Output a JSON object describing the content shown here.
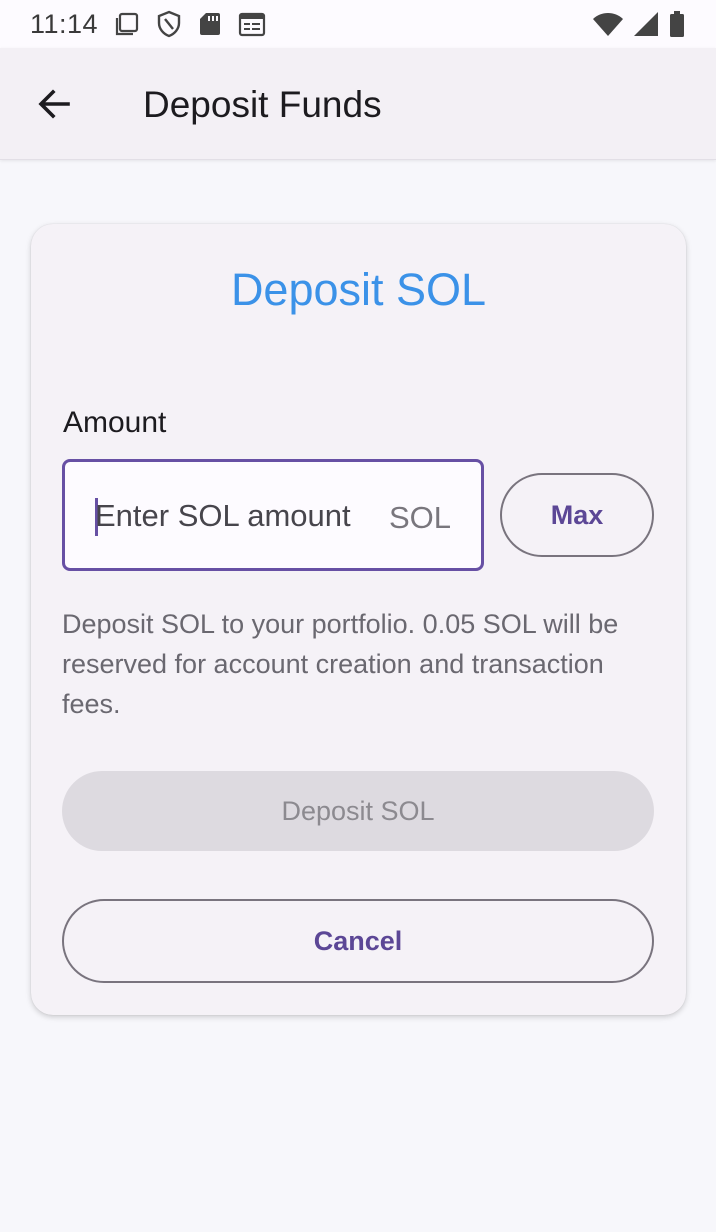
{
  "status_bar": {
    "time": "11:14",
    "icons": [
      "screenshot-icon",
      "vpn-shield-icon",
      "sd-card-icon",
      "calendar-icon",
      "wifi-icon",
      "signal-icon",
      "battery-icon"
    ]
  },
  "app_bar": {
    "back_icon": "arrow-back-icon",
    "title": "Deposit Funds"
  },
  "card": {
    "title": "Deposit SOL",
    "amount_label": "Amount",
    "amount_input": {
      "value": "",
      "placeholder": "Enter SOL amount",
      "suffix": "SOL"
    },
    "max_label": "Max",
    "helper_text": "Deposit SOL to your portfolio. 0.05 SOL will be reserved for account creation and transaction fees.",
    "deposit_label": "Deposit SOL",
    "deposit_enabled": false,
    "cancel_label": "Cancel"
  },
  "colors": {
    "accent": "#6750a4",
    "title_blue": "#3b92e8",
    "disabled_bg": "#dddae0"
  }
}
